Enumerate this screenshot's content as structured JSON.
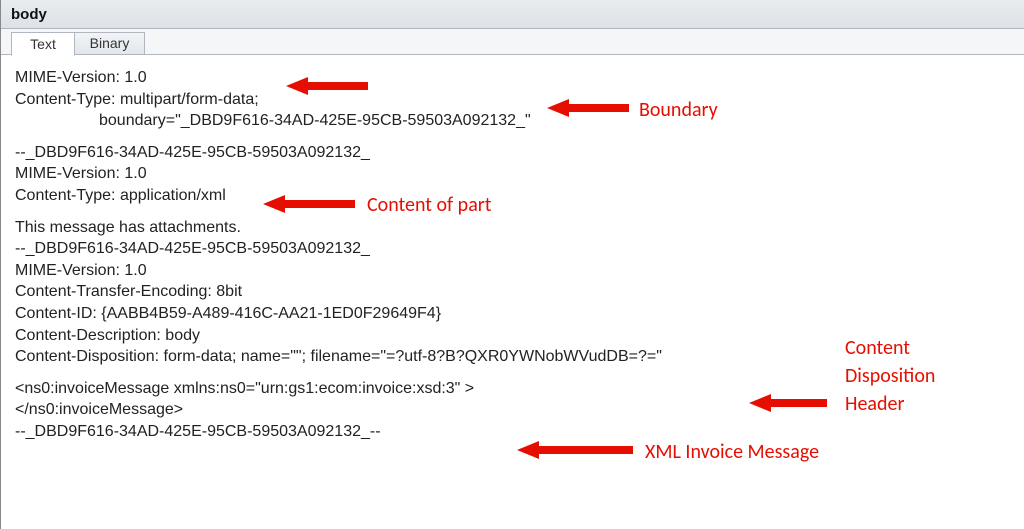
{
  "header": {
    "title": "body"
  },
  "tabs": {
    "text": "Text",
    "binary": "Binary"
  },
  "body": {
    "l1": "MIME-Version: 1.0",
    "l2": "Content-Type: multipart/form-data;",
    "l3": "boundary=\"_DBD9F616-34AD-425E-95CB-59503A092132_\"",
    "l4": "--_DBD9F616-34AD-425E-95CB-59503A092132_",
    "l5": "MIME-Version: 1.0",
    "l6": "Content-Type: application/xml",
    "l7": "This message has attachments.",
    "l8": "--_DBD9F616-34AD-425E-95CB-59503A092132_",
    "l9": "MIME-Version: 1.0",
    "l10": "Content-Transfer-Encoding: 8bit",
    "l11": "Content-ID: {AABB4B59-A489-416C-AA21-1ED0F29649F4}",
    "l12": "Content-Description: body",
    "l13": "Content-Disposition: form-data; name=\"\"; filename=\"=?utf-8?B?QXR0YWNobWVudDB=?=\"",
    "l14": "<ns0:invoiceMessage xmlns:ns0=\"urn:gs1:ecom:invoice:xsd:3\" >",
    "l15": "</ns0:invoiceMessage>",
    "l16": "--_DBD9F616-34AD-425E-95CB-59503A092132_--"
  },
  "annotations": {
    "boundary": "Boundary",
    "content_of_part": "Content of part",
    "content_disposition_header_l1": "Content",
    "content_disposition_header_l2": "Disposition",
    "content_disposition_header_l3": "Header",
    "xml_invoice_message": "XML Invoice Message"
  }
}
